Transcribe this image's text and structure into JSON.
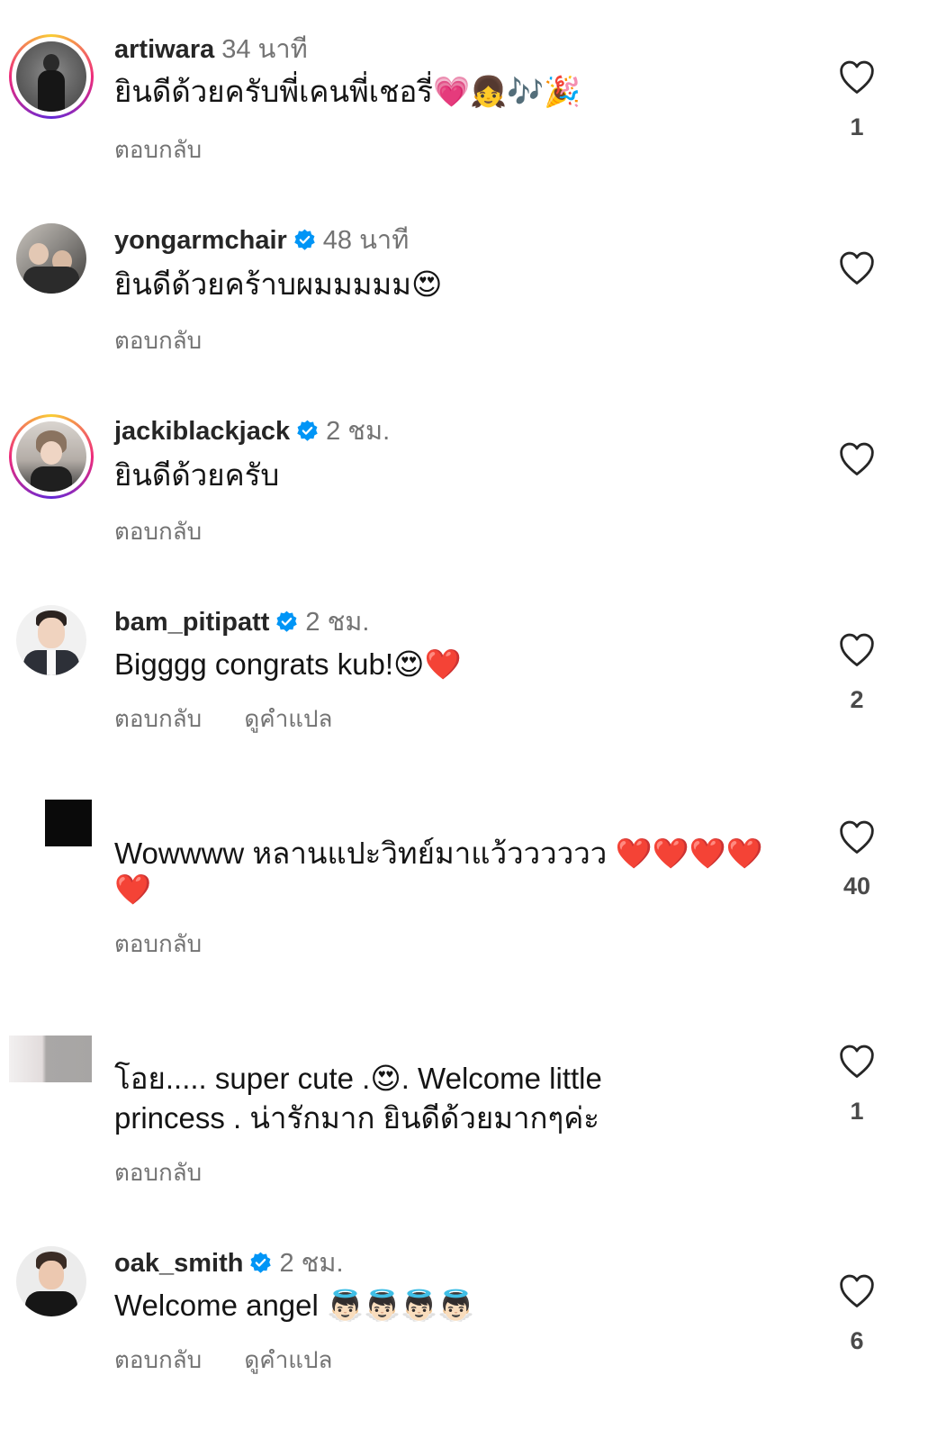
{
  "comments": [
    {
      "username": "artiwara",
      "time": "34 นาที",
      "text": "ยินดีด้วยครับพี่เคนพี่เชอรี่💗👧🎶🎉",
      "reply": "ตอบกลับ",
      "translate": "",
      "likes": "1",
      "verified": false
    },
    {
      "username": "yongarmchair",
      "time": "48 นาที",
      "text": "ยินดีด้วยคร้าบผมมมมม😍",
      "reply": "ตอบกลับ",
      "translate": "",
      "likes": "",
      "verified": true
    },
    {
      "username": "jackiblackjack",
      "time": "2 ชม.",
      "text": "ยินดีด้วยครับ",
      "reply": "ตอบกลับ",
      "translate": "",
      "likes": "",
      "verified": true
    },
    {
      "username": "bam_pitipatt",
      "time": "2 ชม.",
      "text": "Bigggg congrats kub!😍❤️",
      "reply": "ตอบกลับ",
      "translate": "ดูคำแปล",
      "likes": "2",
      "verified": true
    },
    {
      "username": "",
      "time": "",
      "text_line1": "Wowwww หลานแปะวิทย์มาแว้วววววว ❤️❤️❤️❤️",
      "text_line2": "❤️",
      "reply": "ตอบกลับ",
      "translate": "",
      "likes": "40",
      "verified": false
    },
    {
      "username": "",
      "time": "",
      "text_line1": "โอย..... super cute .😍. Welcome little",
      "text_line2": "princess . น่ารักมาก ยินดีด้วยมากๆค่ะ",
      "reply": "ตอบกลับ",
      "translate": "",
      "likes": "1",
      "verified": false
    },
    {
      "username": "oak_smith",
      "time": "2 ชม.",
      "text": "Welcome angel 👼🏻👼🏻👼🏻👼🏻",
      "reply": "ตอบกลับ",
      "translate": "ดูคำแปล",
      "likes": "6",
      "verified": true
    }
  ],
  "icons": {
    "like": "heart-outline-icon",
    "verified": "verified-badge-icon"
  },
  "colors": {
    "verified": "#0095f6",
    "muted": "#737373"
  }
}
